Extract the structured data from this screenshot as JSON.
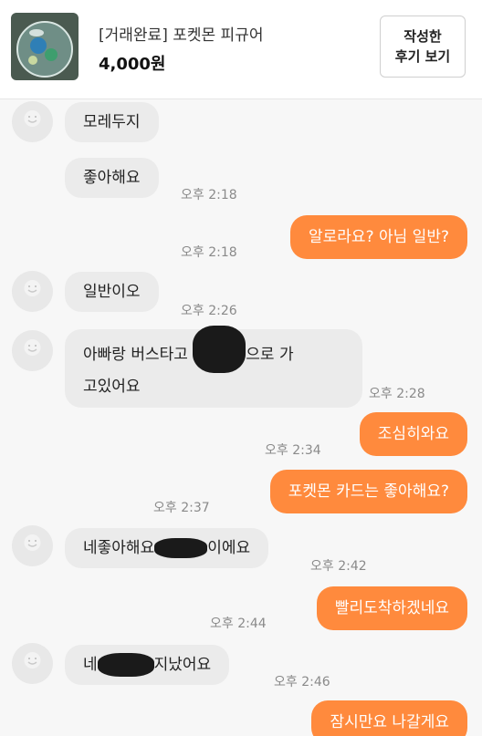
{
  "header": {
    "product_title": "[거래완료] 포켓몬 피규어",
    "product_price": "4,000원",
    "review_button_line1": "작성한",
    "review_button_line2": "후기 보기"
  },
  "messages": [
    {
      "from": "other",
      "text": "모레두지",
      "time": ""
    },
    {
      "from": "other",
      "text": "좋아해요",
      "time": "오후 2:18"
    },
    {
      "from": "me",
      "text": "알로라요? 아님 일반?",
      "time": "오후 2:18"
    },
    {
      "from": "other",
      "text": "일반이오",
      "time": "오후 2:26"
    },
    {
      "from": "other",
      "text_before": "아빠랑 버스타고 ",
      "text_after": "으로  가",
      "text_line2": "고있어요",
      "time": "오후 2:28"
    },
    {
      "from": "me",
      "text": "조심히와요",
      "time": "오후 2:34"
    },
    {
      "from": "me",
      "text": "포켓몬 카드는 좋아해요?",
      "time": "오후 2:37"
    },
    {
      "from": "other",
      "text_before": "네좋아해요",
      "text_after": "이에요",
      "time": "오후 2:42"
    },
    {
      "from": "me",
      "text": "빨리도착하겠네요",
      "time": "오후 2:44"
    },
    {
      "from": "other",
      "text_before": "네",
      "text_after": "지났어요",
      "time": "오후 2:46"
    },
    {
      "from": "me",
      "text": "잠시만요 나갈게요",
      "time": ""
    }
  ],
  "colors": {
    "accent": "#ff8a3d",
    "bubble_other": "#ebebeb",
    "background": "#f7f7f7"
  }
}
